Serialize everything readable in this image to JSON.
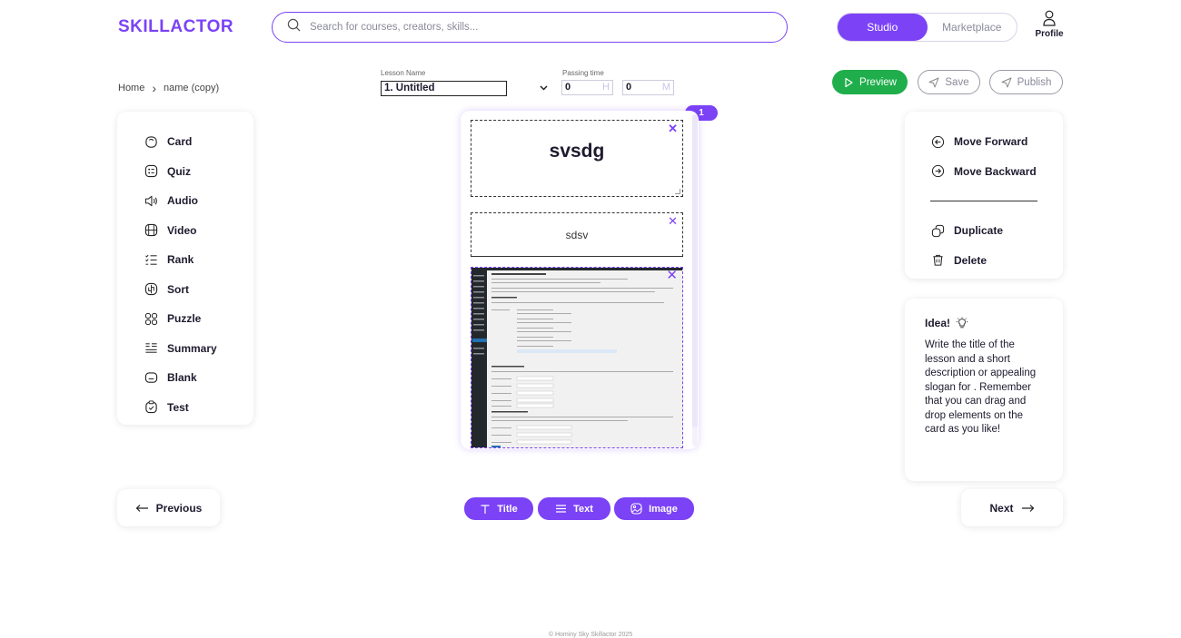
{
  "header": {
    "logo": "SKILLACTOR",
    "search_placeholder": "Search for courses, creators, skills...",
    "tabs": [
      {
        "label": "Studio",
        "active": true
      },
      {
        "label": "Marketplace",
        "active": false
      }
    ],
    "profile_label": "Profile"
  },
  "breadcrumb": {
    "home": "Home",
    "separator": "›",
    "current": "name (copy)"
  },
  "lesson": {
    "name_label": "Lesson Name",
    "name_value": "1. Untitled",
    "passing_label": "Passing time",
    "hours_value": "0",
    "hours_unit": "H",
    "minutes_value": "0",
    "minutes_unit": "M"
  },
  "actions": {
    "preview": "Preview",
    "save": "Save",
    "publish": "Publish"
  },
  "tools": [
    {
      "label": "Card",
      "icon": "card-icon"
    },
    {
      "label": "Quiz",
      "icon": "quiz-icon"
    },
    {
      "label": "Audio",
      "icon": "audio-icon"
    },
    {
      "label": "Video",
      "icon": "video-icon"
    },
    {
      "label": "Rank",
      "icon": "rank-icon"
    },
    {
      "label": "Sort",
      "icon": "sort-icon"
    },
    {
      "label": "Puzzle",
      "icon": "puzzle-icon"
    },
    {
      "label": "Summary",
      "icon": "summary-icon"
    },
    {
      "label": "Blank",
      "icon": "blank-icon"
    },
    {
      "label": "Test",
      "icon": "test-icon"
    }
  ],
  "card": {
    "badge": "1",
    "title_text": "svsdg",
    "body_text": "sdsv"
  },
  "card_actions": {
    "move_forward": "Move Forward",
    "move_backward": "Move Backward",
    "duplicate": "Duplicate",
    "delete": "Delete"
  },
  "idea": {
    "title": "Idea!",
    "text": "Write the title of the lesson and a short description or appealing slogan for . Remember that you can drag and drop elements on the card as you like!"
  },
  "nav": {
    "previous": "Previous",
    "next": "Next"
  },
  "add_elements": {
    "title": "Title",
    "text": "Text",
    "image": "Image"
  },
  "footer": {
    "copyright": "© Hominy Sky Skillactor 2025"
  },
  "colors": {
    "accent": "#7b42f6",
    "preview_green": "#1fae4b"
  }
}
